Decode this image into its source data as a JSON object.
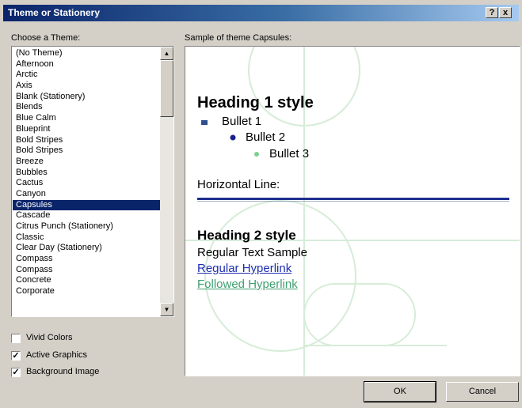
{
  "window": {
    "title": "Theme or Stationery",
    "help_btn": "?",
    "close_btn": "x"
  },
  "choose_label": "Choose a Theme:",
  "sample_label": "Sample of theme Capsules:",
  "themes": [
    "(No Theme)",
    "Afternoon",
    "Arctic",
    "Axis",
    "Blank (Stationery)",
    "Blends",
    "Blue Calm",
    "Blueprint",
    "Bold Stripes",
    "Bold Stripes",
    "Breeze",
    "Bubbles",
    "Cactus",
    "Canyon",
    "Capsules",
    "Cascade",
    "Citrus Punch (Stationery)",
    "Classic",
    "Clear Day (Stationery)",
    "Compass",
    "Compass",
    "Concrete",
    "Corporate"
  ],
  "selected_theme": "Capsules",
  "scroll": {
    "up_icon": "▲",
    "down_icon": "▼"
  },
  "options": {
    "vivid_colors": {
      "label": "Vivid Colors",
      "checked": false
    },
    "active_graphics": {
      "label": "Active Graphics",
      "checked": true
    },
    "background_image": {
      "label": "Background Image",
      "checked": true
    }
  },
  "preview": {
    "heading1": "Heading 1 style",
    "bullet1": "Bullet 1",
    "bullet2": "Bullet 2",
    "bullet3": "Bullet 3",
    "hline_label": "Horizontal Line:",
    "heading2": "Heading 2 style",
    "regular_text": "Regular Text Sample",
    "hyperlink": "Regular Hyperlink",
    "followed_hyperlink": "Followed Hyperlink",
    "colors": {
      "rule": "#1f2f8f",
      "link": "#1f2faf",
      "followed": "#3fa070",
      "bullet2": "#1a1f8f",
      "bullet3": "#7fcf8f"
    }
  },
  "buttons": {
    "ok": "OK",
    "cancel": "Cancel"
  }
}
